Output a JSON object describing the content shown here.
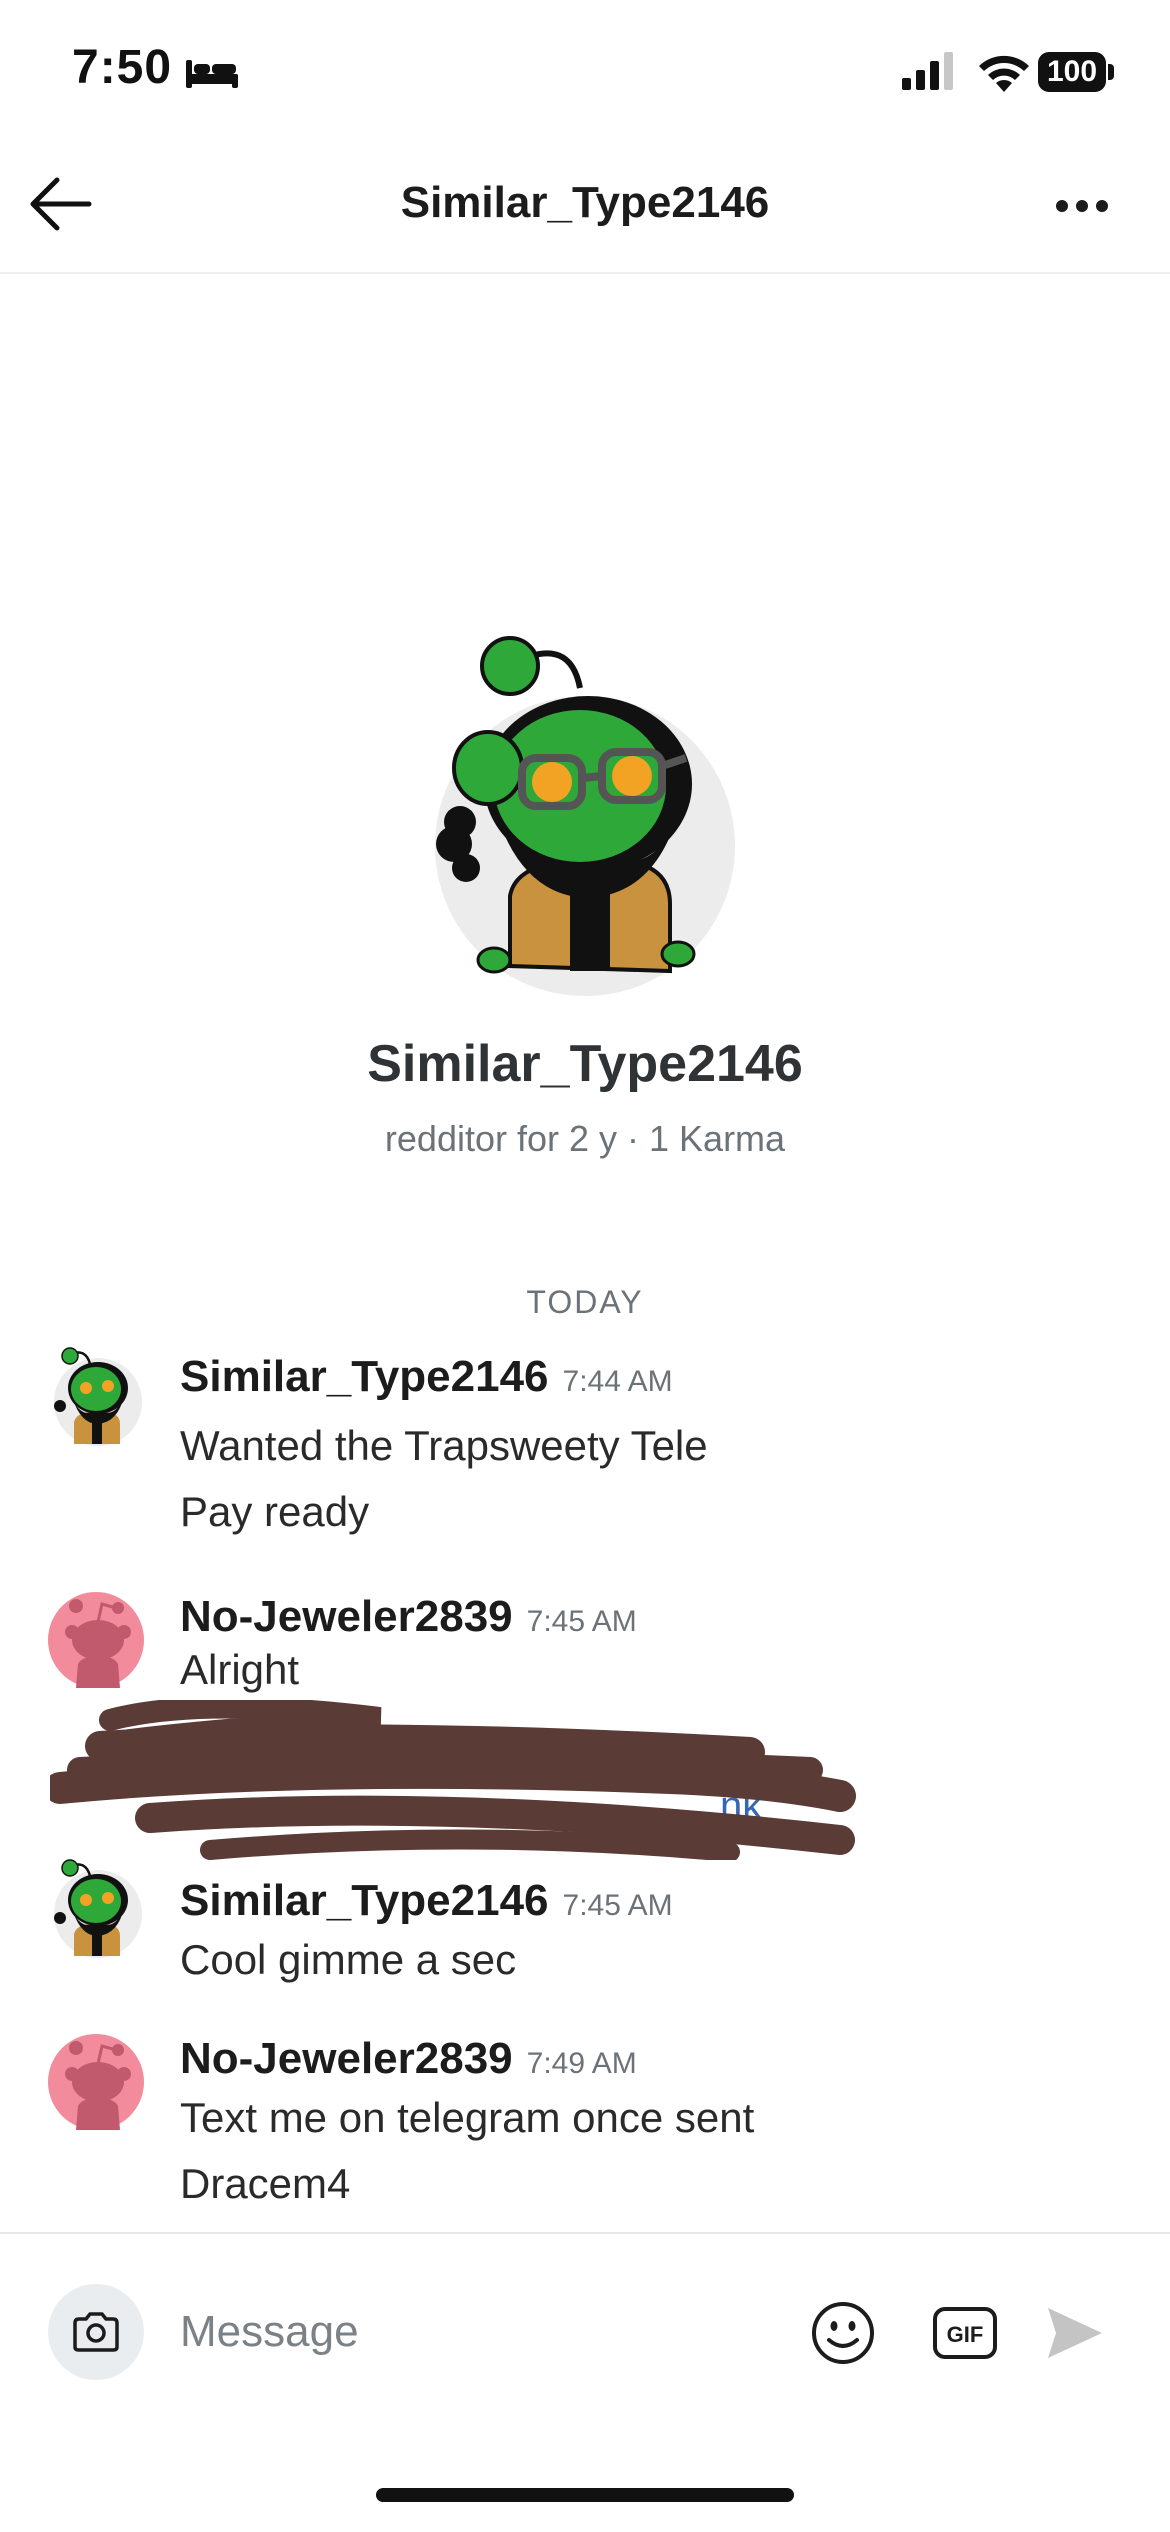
{
  "status_bar": {
    "time": "7:50",
    "battery": "100"
  },
  "header": {
    "title": "Similar_Type2146"
  },
  "profile": {
    "name": "Similar_Type2146",
    "meta": "redditor for 2 y · 1 Karma"
  },
  "day_separator": "TODAY",
  "messages": [
    {
      "user": "Similar_Type2146",
      "time": "7:44 AM",
      "lines": [
        "Wanted the Trapsweety Tele",
        "Pay ready"
      ]
    },
    {
      "user": "No-Jeweler2839",
      "time": "7:45 AM",
      "lines": [
        "Alright"
      ],
      "link_fragment": "nk"
    },
    {
      "user": "Similar_Type2146",
      "time": "7:45 AM",
      "lines": [
        "Cool gimme a sec"
      ]
    },
    {
      "user": "No-Jeweler2839",
      "time": "7:49 AM",
      "lines": [
        "Text me on telegram once sent",
        "Dracem4"
      ]
    }
  ],
  "composer": {
    "placeholder": "Message",
    "gif_label": "GIF"
  },
  "icons": {
    "back": "arrow-left-icon",
    "more": "more-horizontal-icon",
    "camera": "camera-icon",
    "emoji": "emoji-icon",
    "gif": "gif-icon",
    "send": "send-icon"
  },
  "colors": {
    "snoo_green": "#2fa83a",
    "snoo_pink_bg": "#f28b9b",
    "scribble": "#5a3b36",
    "link": "#3466b5"
  }
}
